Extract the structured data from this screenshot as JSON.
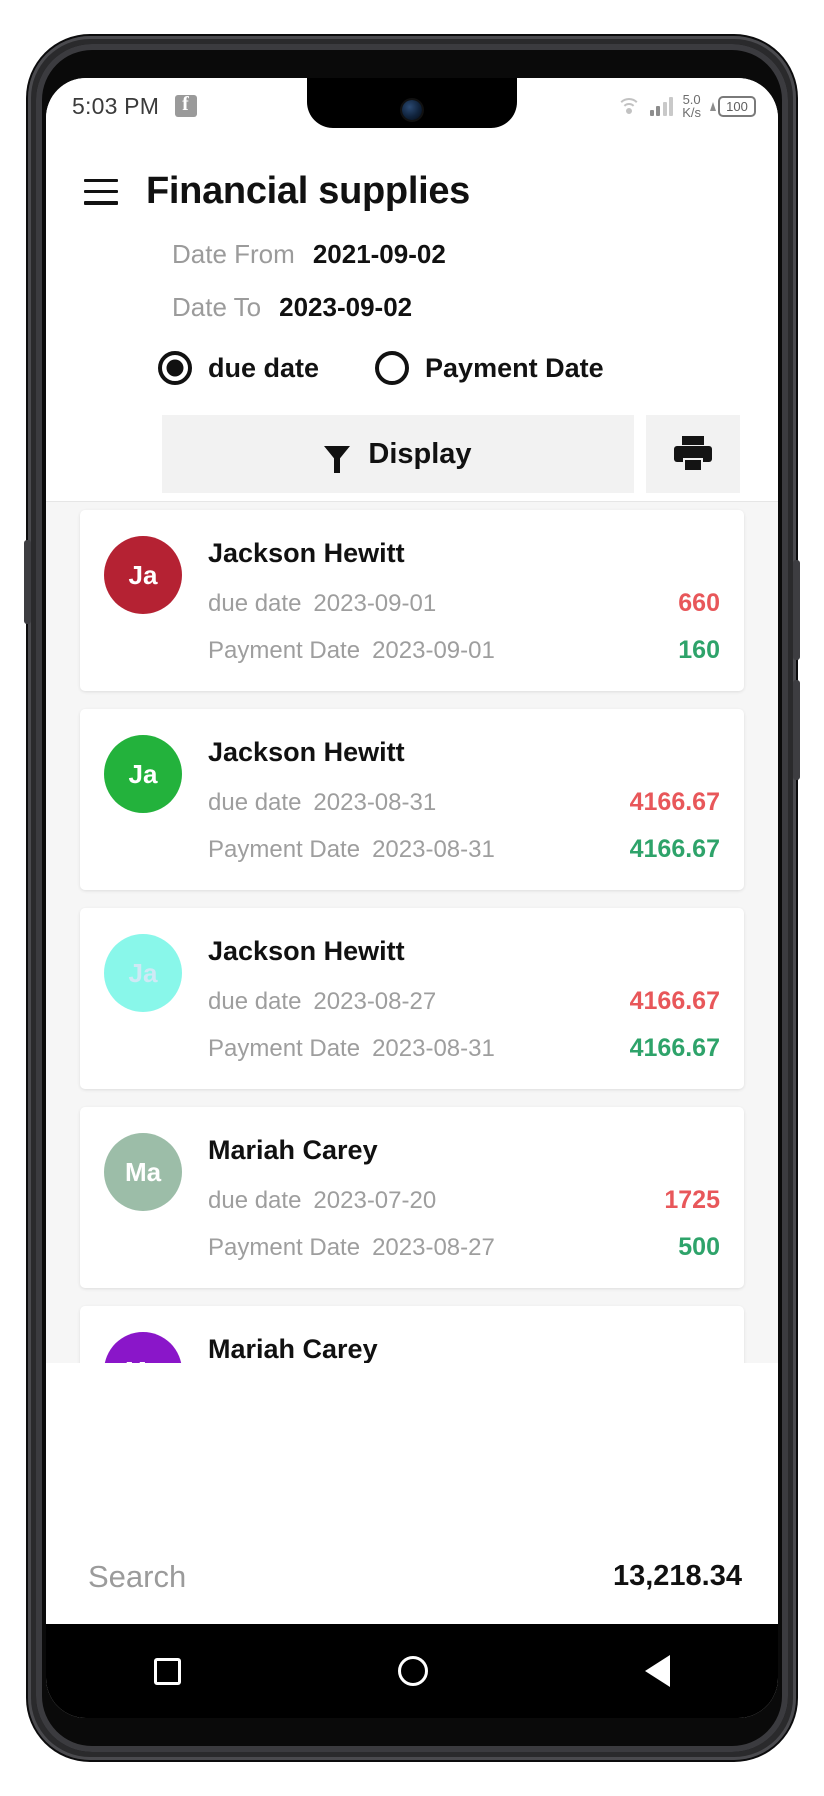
{
  "status_bar": {
    "time": "5:03 PM",
    "app_icon": "facebook-icon",
    "network_speed": "5.0",
    "network_speed_unit": "K/s",
    "battery_level": "100"
  },
  "appbar": {
    "menu_icon": "hamburger-menu-icon",
    "title": "Financial supplies"
  },
  "filters": {
    "date_from_label": "Date From",
    "date_from_value": "2021-09-02",
    "date_to_label": "Date To",
    "date_to_value": "2023-09-02",
    "radios": [
      {
        "label": "due date",
        "selected": true
      },
      {
        "label": "Payment Date",
        "selected": false
      }
    ],
    "display_button": "Display",
    "display_icon": "filter-funnel-icon",
    "print_icon": "printer-icon"
  },
  "list": {
    "due_label": "due date",
    "payment_label": "Payment Date",
    "items": [
      {
        "initials": "Ja",
        "avatar_color": "#b52233",
        "name": "Jackson Hewitt",
        "due_date": "2023-09-01",
        "due_amount": "660",
        "payment_date": "2023-09-01",
        "payment_amount": "160"
      },
      {
        "initials": "Ja",
        "avatar_color": "#23b23c",
        "name": "Jackson Hewitt",
        "due_date": "2023-08-31",
        "due_amount": "4166.67",
        "payment_date": "2023-08-31",
        "payment_amount": "4166.67"
      },
      {
        "initials": "Ja",
        "avatar_color": "#89f7ea",
        "name": "Jackson Hewitt",
        "due_date": "2023-08-27",
        "due_amount": "4166.67",
        "payment_date": "2023-08-31",
        "payment_amount": "4166.67"
      },
      {
        "initials": "Ma",
        "avatar_color": "#9cbda8",
        "name": "Mariah Carey",
        "due_date": "2023-07-20",
        "due_amount": "1725",
        "payment_date": "2023-08-27",
        "payment_amount": "500"
      },
      {
        "initials": "Ma",
        "avatar_color": "#8a16c9",
        "name": "Mariah Carey",
        "due_date": "",
        "due_amount": "",
        "payment_date": "",
        "payment_amount": ""
      }
    ]
  },
  "bottom_bar": {
    "search_placeholder": "Search",
    "search_value": "",
    "total": "13,218.34"
  },
  "nav_bar": {
    "recents_icon": "square-icon",
    "home_icon": "circle-icon",
    "back_icon": "triangle-back-icon"
  },
  "colors": {
    "due_amount": "#e8575a",
    "paid_amount": "#2ea36a",
    "button_bg": "#f2f2f2"
  }
}
